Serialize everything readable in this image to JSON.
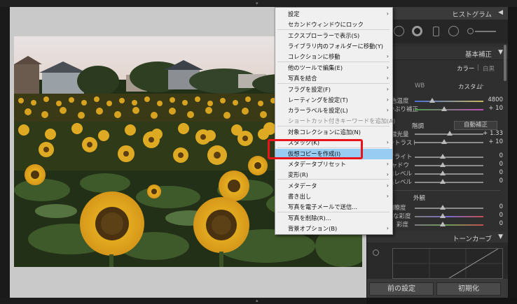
{
  "histogram_panel": {
    "title": "ヒストグラム"
  },
  "basic_panel": {
    "title": "基本補正",
    "treatment": {
      "color": "カラー",
      "separator": "|",
      "bw": "白黒"
    },
    "wb": {
      "label": "WB",
      "value": "カスタム",
      "chevron": "÷"
    },
    "temperature": {
      "label": "色温度",
      "value": "4800"
    },
    "tint": {
      "label": "色かぶり補正",
      "value": "+ 10"
    },
    "tone_label": "階調",
    "auto_button": "自動補正",
    "exposure": {
      "label": "露光量",
      "value": "+ 1.33"
    },
    "contrast": {
      "label": "コントラスト",
      "value": "+ 10"
    },
    "highlights": {
      "label": "ハイライト",
      "value": "0"
    },
    "shadows": {
      "label": "シャドウ",
      "value": "0"
    },
    "whites": {
      "label": "白レベル",
      "value": "0"
    },
    "blacks": {
      "label": "黒レベル",
      "value": "0"
    },
    "presence_label": "外観",
    "clarity": {
      "label": "明瞭度",
      "value": "0"
    },
    "vibrance": {
      "label": "自然な彩度",
      "value": "0"
    },
    "saturation": {
      "label": "彩度",
      "value": "0"
    }
  },
  "tone_curve_panel": {
    "title": "トーンカーブ"
  },
  "bottom_buttons": {
    "previous": "前の設定",
    "reset": "初期化"
  },
  "context_menu": {
    "items": [
      {
        "label": "設定",
        "submenu": true,
        "enabled": true
      },
      {
        "label": "セカンドウィンドウにロック",
        "submenu": false,
        "enabled": true
      },
      {
        "label": "エクスプローラーで表示(S)",
        "submenu": false,
        "enabled": true
      },
      {
        "label": "ライブラリ内のフォルダーに移動(Y)",
        "submenu": false,
        "enabled": true
      },
      {
        "label": "コレクションに移動",
        "submenu": true,
        "enabled": true
      },
      {
        "label": "他のツールで編集(E)",
        "submenu": true,
        "enabled": true
      },
      {
        "label": "写真を結合",
        "submenu": true,
        "enabled": true
      },
      {
        "label": "フラグを設定(F)",
        "submenu": true,
        "enabled": true
      },
      {
        "label": "レーティングを設定(T)",
        "submenu": true,
        "enabled": true
      },
      {
        "label": "カラーラベルを設定(L)",
        "submenu": true,
        "enabled": true
      },
      {
        "label": "ショートカット付きキーワードを追加(A)",
        "submenu": false,
        "enabled": false
      },
      {
        "label": "対象コレクションに追加(N)",
        "submenu": false,
        "enabled": true
      },
      {
        "label": "スタック(K)",
        "submenu": true,
        "enabled": true
      },
      {
        "label": "仮想コピーを作成(I)",
        "submenu": false,
        "enabled": true,
        "highlighted": true
      },
      {
        "label": "メタデータプリセット",
        "submenu": true,
        "enabled": true
      },
      {
        "label": "変形(R)",
        "submenu": true,
        "enabled": true
      },
      {
        "label": "メタデータ",
        "submenu": true,
        "enabled": true
      },
      {
        "label": "書き出し",
        "submenu": true,
        "enabled": true
      },
      {
        "label": "写真を電子メールで送信...",
        "submenu": false,
        "enabled": true
      },
      {
        "label": "写真を削除(R)...",
        "submenu": false,
        "enabled": true
      },
      {
        "label": "背景オプション(B)",
        "submenu": true,
        "enabled": true
      }
    ],
    "submenu_arrow": "›"
  },
  "colors": {
    "highlight": "#99ccf3",
    "annotation": "#e8141a",
    "panel_bg": "#2f2f2f",
    "photo_bg": "#c9c9c9"
  },
  "icons": {
    "panel_collapse": "triangle-left-icon",
    "panel_expand": "triangle-down-icon"
  }
}
